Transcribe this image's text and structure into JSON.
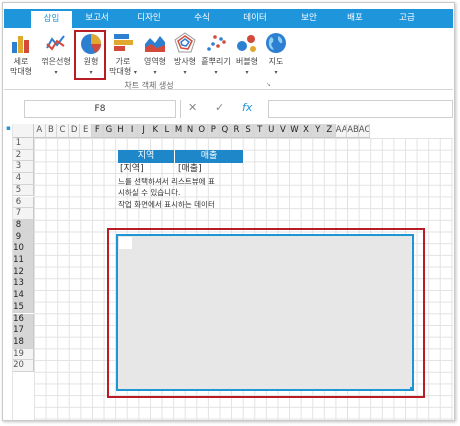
{
  "tabs": [
    {
      "label": "삽입",
      "active": true
    },
    {
      "label": "보고서",
      "active": false
    },
    {
      "label": "디자인",
      "active": false
    },
    {
      "label": "수식",
      "active": false
    },
    {
      "label": "데이터",
      "active": false
    },
    {
      "label": "보안",
      "active": false
    },
    {
      "label": "배포",
      "active": false
    },
    {
      "label": "고급",
      "active": false
    }
  ],
  "ribbon": {
    "buttons": [
      {
        "line1": "세로",
        "line2": "막대형",
        "icon": "column-chart-icon"
      },
      {
        "line1": "꺾은선형",
        "line2": "",
        "icon": "line-chart-icon"
      },
      {
        "line1": "원형",
        "line2": "",
        "icon": "pie-chart-icon"
      },
      {
        "line1": "가로",
        "line2": "막대형",
        "icon": "bar-chart-icon"
      },
      {
        "line1": "영역형",
        "line2": "",
        "icon": "area-chart-icon"
      },
      {
        "line1": "방사형",
        "line2": "",
        "icon": "radar-chart-icon"
      },
      {
        "line1": "흩뿌리기",
        "line2": "",
        "icon": "scatter-chart-icon"
      },
      {
        "line1": "버블형",
        "line2": "",
        "icon": "bubble-chart-icon"
      },
      {
        "line1": "지도",
        "line2": "",
        "icon": "map-globe-icon"
      }
    ],
    "group_label": "차트 객체 생성",
    "caret": "▾",
    "launcher": "↘"
  },
  "formula_bar": {
    "name_box": "F8",
    "cancel": "✕",
    "confirm": "✓",
    "fx": "fx"
  },
  "columns": [
    "A",
    "B",
    "C",
    "D",
    "E",
    "F",
    "G",
    "H",
    "I",
    "J",
    "K",
    "L",
    "M",
    "N",
    "O",
    "P",
    "Q",
    "R",
    "S",
    "T",
    "U",
    "V",
    "W",
    "X",
    "Y",
    "Z",
    "AA",
    "AB",
    "AC"
  ],
  "selected_columns": [
    "F",
    "G",
    "H",
    "I",
    "J",
    "K",
    "L",
    "M",
    "N",
    "O",
    "P",
    "Q",
    "R",
    "S",
    "T",
    "U",
    "V",
    "W",
    "X",
    "Y",
    "Z"
  ],
  "rows": [
    "1",
    "2",
    "3",
    "4",
    "5",
    "6",
    "7",
    "8",
    "9",
    "10",
    "11",
    "12",
    "13",
    "14",
    "15",
    "16",
    "17",
    "18",
    "19",
    "20"
  ],
  "selected_rows": [
    "8",
    "9",
    "10",
    "11",
    "12",
    "13",
    "14",
    "15",
    "16",
    "17",
    "18"
  ],
  "table": {
    "headers": [
      "지역",
      "매출"
    ],
    "row3": [
      "[지역]",
      "[매출]"
    ],
    "notes": [
      "느를 선택하셔서 리스트뷰에 표",
      "시하실 수 있습니다.",
      "작업 화면에서 표시하는 데이터"
    ]
  },
  "colors": {
    "accent": "#1f96dc",
    "table_header": "#1d87c9",
    "highlight": "#b81d25",
    "selection": "#e7e7e7"
  }
}
